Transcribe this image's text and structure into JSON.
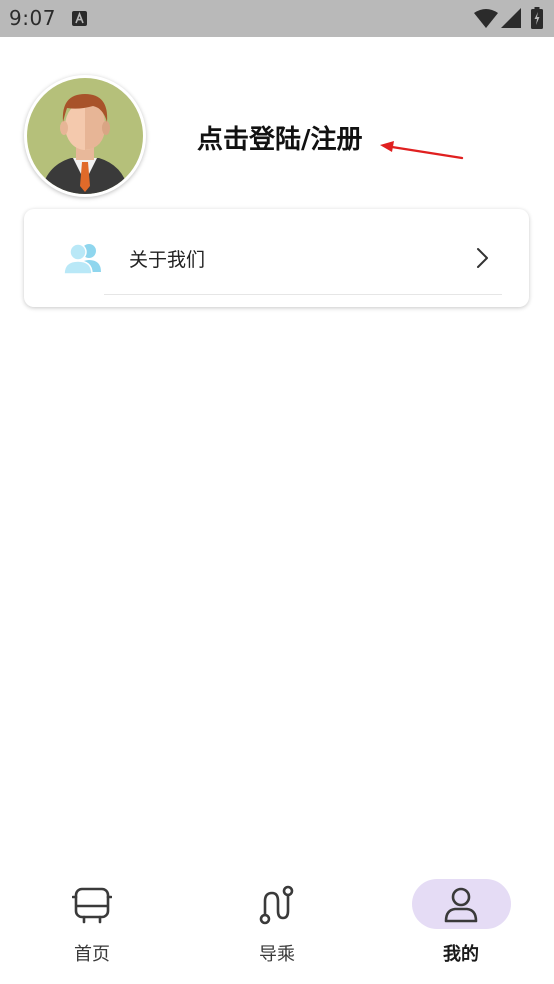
{
  "status_bar": {
    "time": "9:07",
    "icons": [
      "a-notification-icon",
      "wifi-icon",
      "signal-icon",
      "battery-icon"
    ],
    "background": "#b9b9b9"
  },
  "profile": {
    "avatar_icon": "user-avatar-icon",
    "login_label": "点击登陆/注册",
    "arrow_color": "#e02020"
  },
  "menu": {
    "items": [
      {
        "label": "关于我们",
        "icon": "users-icon",
        "trailing_icon": "chevron-right-icon"
      }
    ]
  },
  "bottom_nav": {
    "active_index": 2,
    "active_pill_color": "#e5dcf5",
    "items": [
      {
        "label": "首页",
        "icon": "bus-icon"
      },
      {
        "label": "导乘",
        "icon": "route-icon"
      },
      {
        "label": "我的",
        "icon": "person-icon"
      }
    ]
  }
}
